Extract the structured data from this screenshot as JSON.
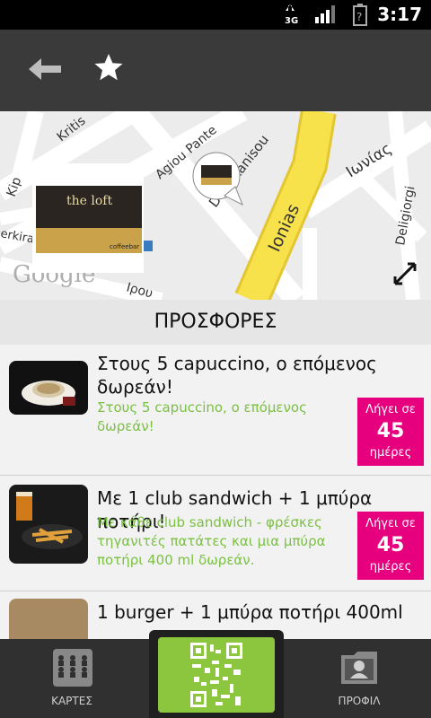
{
  "status": {
    "network": "3G",
    "time": "3:17"
  },
  "map": {
    "streets": [
      "Kritis",
      "Agiou Pante",
      "Dodekanisou",
      "Ιωνίας",
      "Ionias",
      "Deligiorgi",
      "Kip",
      "erkiral",
      "Ιρου"
    ],
    "google_logo": "Google",
    "venue_name": "the loft",
    "venue_sub": "coffeebar"
  },
  "offers_section": {
    "title": "ΠΡΟΣΦΟΡΕΣ"
  },
  "offers": [
    {
      "title": "Στους 5 capuccino, ο επόμενος δωρεάν!",
      "desc": "Στους 5 capuccino, ο επόμενος δωρεάν!",
      "badge_prefix": "Λήγει σε",
      "badge_days": "45",
      "badge_suffix": "ημέρες"
    },
    {
      "title": "Με 1 club sandwich + 1 μπύρα ποτήρι!",
      "desc": "Με κάθε club sandwich - φρέσκες τηγανιτές πατάτες και μια μπύρα ποτήρι 400 ml δωρεάν.",
      "badge_prefix": "Λήγει σε",
      "badge_days": "45",
      "badge_suffix": "ημέρες"
    },
    {
      "title": "1 burger + 1 μπύρα ποτήρι 400ml"
    }
  ],
  "bottom_nav": {
    "cards_label": "ΚΑΡΤΕΣ",
    "profile_label": "ΠΡΟΦΙΛ"
  },
  "colors": {
    "accent_green": "#8cc63f",
    "badge_pink": "#e6007e",
    "desc_green": "#7bc043",
    "map_road_yellow": "#f7e24b"
  },
  "icons": [
    "back-arrow-icon",
    "star-icon",
    "expand-icon",
    "cards-grid-icon",
    "qr-code-icon",
    "profile-folder-icon",
    "network-3g-icon",
    "signal-icon",
    "battery-icon"
  ]
}
